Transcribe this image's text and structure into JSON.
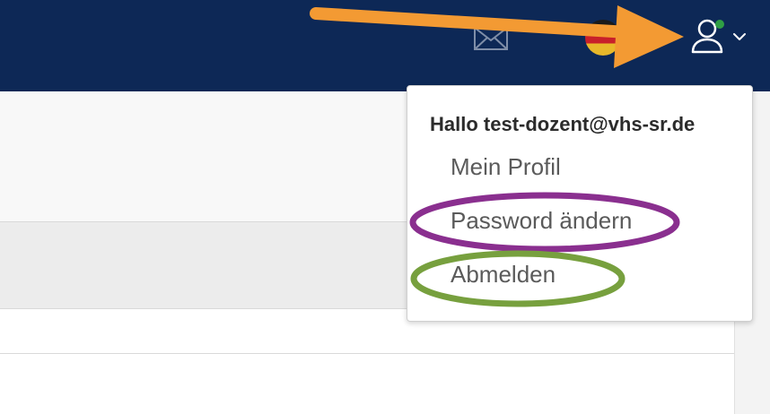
{
  "navbar": {
    "icons": {
      "mail": "mail-icon",
      "language": "flag-icon",
      "user": "user-icon",
      "status": "online-status-dot",
      "caret": "chevron-down-icon"
    },
    "colors": {
      "background": "#0d2856",
      "online_status": "#2f9e44"
    }
  },
  "user_menu": {
    "greeting": "Hallo test-dozent@vhs-sr.de",
    "items": [
      {
        "label": "Mein Profil"
      },
      {
        "label": "Password ändern"
      },
      {
        "label": "Abmelden"
      }
    ]
  },
  "annotations": {
    "arrow_color": "#f39a33",
    "password_highlight_color": "#8a2f8f",
    "logout_highlight_color": "#77a03e"
  }
}
